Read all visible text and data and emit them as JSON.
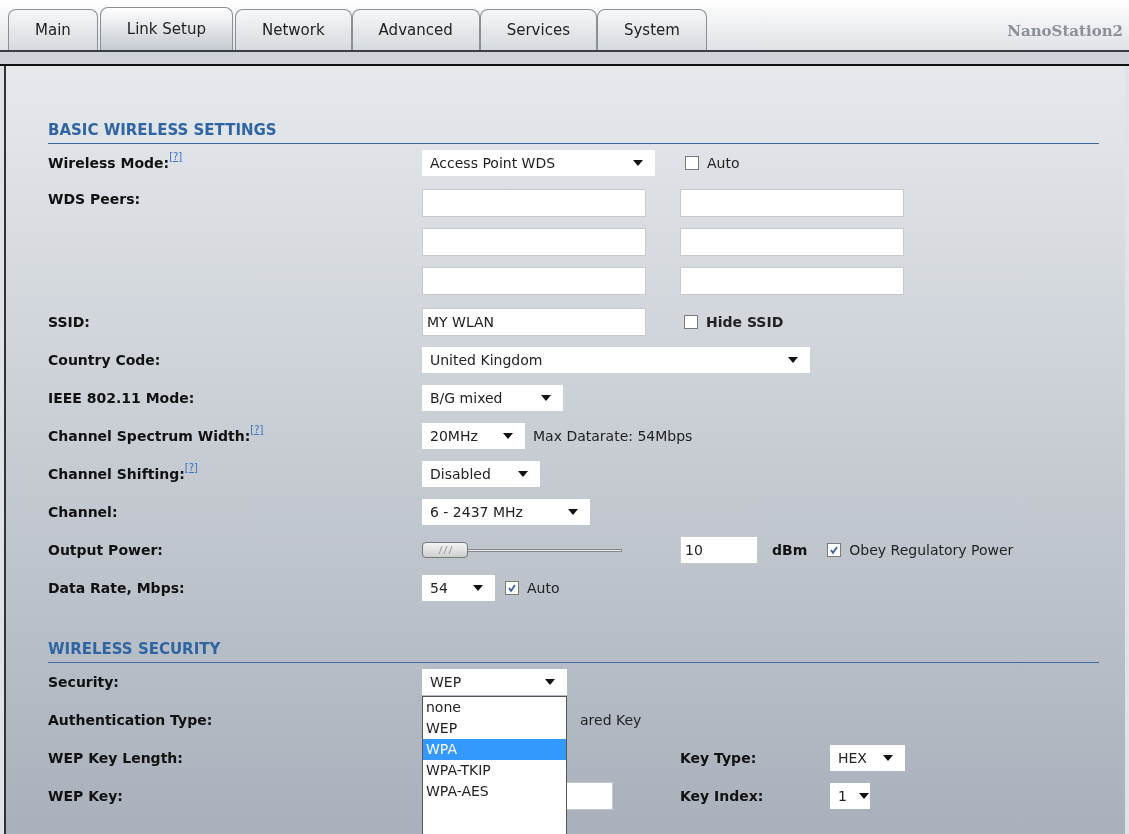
{
  "tabs": [
    {
      "label": "Main",
      "selected": false
    },
    {
      "label": "Link Setup",
      "selected": true
    },
    {
      "label": "Network",
      "selected": false
    },
    {
      "label": "Advanced",
      "selected": false
    },
    {
      "label": "Services",
      "selected": false
    },
    {
      "label": "System",
      "selected": false
    }
  ],
  "brand": "NanoStation2",
  "basic": {
    "title": "BASIC WIRELESS SETTINGS",
    "rows": [
      {
        "kind": "select-check",
        "label": "Wireless Mode:",
        "help": "[?]",
        "select": "Access Point WDS",
        "check": {
          "label": "Auto",
          "checked": false
        }
      },
      {
        "kind": "peers",
        "label": "WDS Peers:"
      },
      {
        "kind": "input-check",
        "label": "SSID:",
        "value": "MY WLAN",
        "check": {
          "label": "Hide SSID",
          "checked": false
        }
      },
      {
        "kind": "select",
        "label": "Country Code:",
        "select": "United Kingdom"
      },
      {
        "kind": "select",
        "label": "IEEE 802.11 Mode:",
        "select": "B/G mixed"
      },
      {
        "kind": "select-note",
        "label": "Channel Spectrum Width:",
        "help": "[?]",
        "select": "20MHz",
        "note": "Max Datarate: 54Mbps"
      },
      {
        "kind": "select",
        "label": "Channel Shifting:",
        "help": "[?]",
        "select": "Disabled"
      },
      {
        "kind": "select",
        "label": "Channel:",
        "select": "6 - 2437 MHz"
      },
      {
        "kind": "slider",
        "label": "Output Power:",
        "level": 0,
        "value": "10",
        "unit": "dBm",
        "check": {
          "label": "Obey Regulatory Power",
          "checked": true
        }
      },
      {
        "kind": "select-check",
        "label": "Data Rate, Mbps:",
        "select": "54",
        "check": {
          "label": "Auto",
          "checked": true
        }
      }
    ]
  },
  "security": {
    "title": "WIRELESS SECURITY",
    "security_label": "Security:",
    "security_select": "WEP",
    "options": [
      {
        "label": "none",
        "selected": false
      },
      {
        "label": "WEP",
        "selected": false
      },
      {
        "label": "WPA",
        "selected": true
      },
      {
        "label": "WPA-TKIP",
        "selected": false
      },
      {
        "label": "WPA-AES",
        "selected": false
      }
    ],
    "auth_label": "Authentication Type:",
    "auth_value": "ared Key",
    "length_label": "WEP Key Length:",
    "key_type_label": "Key Type:",
    "key_type": "HEX",
    "key_label": "WEP Key:",
    "key_index_label": "Key Index:",
    "key_index": "1"
  }
}
